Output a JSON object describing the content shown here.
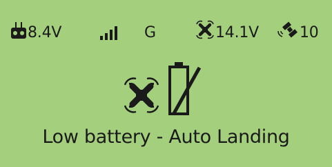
{
  "status": {
    "controller_voltage": "8.4V",
    "mode": "G",
    "drone_voltage": "14.1V",
    "satellites": "10",
    "signal_bars_level": 4,
    "icons": [
      "controller-icon",
      "signal-bars-icon",
      "drone-icon",
      "satellite-icon"
    ]
  },
  "alert": {
    "message": "Low battery - Auto Landing",
    "icons": [
      "drone-icon",
      "battery-slash-icon"
    ]
  },
  "colors": {
    "background": "#a4d07e",
    "foreground": "#1a1a1a"
  }
}
